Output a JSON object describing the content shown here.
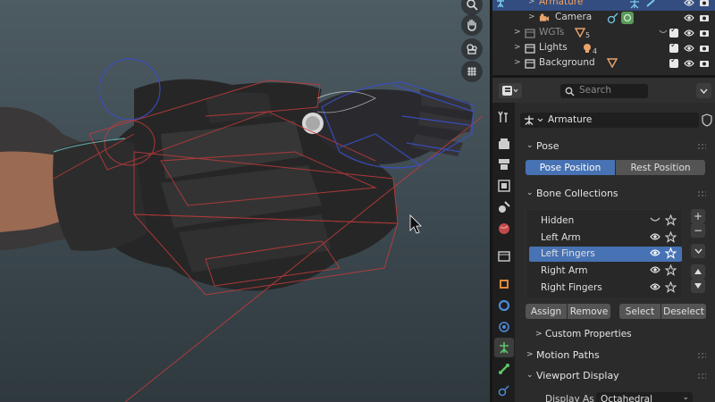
{
  "outliner": {
    "rows": [
      {
        "label": "Armature",
        "badge": ""
      },
      {
        "label": "Camera",
        "badge": ""
      },
      {
        "label": "WGTs",
        "badge": "5"
      },
      {
        "label": "Lights",
        "badge": "4"
      },
      {
        "label": "Background",
        "badge": ""
      }
    ]
  },
  "properties": {
    "search_placeholder": "Search",
    "context_name": "Armature",
    "panels": {
      "pose": "Pose",
      "bone_collections": "Bone Collections",
      "custom_properties": "Custom Properties",
      "motion_paths": "Motion Paths",
      "viewport_display": "Viewport Display"
    },
    "pose_buttons": {
      "pose_position": "Pose Position",
      "rest_position": "Rest Position"
    },
    "bone_collections": [
      {
        "name": "Hidden",
        "visible": false
      },
      {
        "name": "Left Arm",
        "visible": true
      },
      {
        "name": "Left Fingers",
        "visible": true,
        "active": true
      },
      {
        "name": "Right Arm",
        "visible": true
      },
      {
        "name": "Right Fingers",
        "visible": true
      }
    ],
    "bc_buttons": {
      "assign": "Assign",
      "remove": "Remove",
      "select": "Select",
      "deselect": "Deselect"
    },
    "viewport_display": {
      "display_as_label": "Display As",
      "display_as_value": "Octahedral"
    }
  },
  "icons": {
    "navigation": [
      "zoom-icon",
      "hand-pan-icon",
      "camera-view-icon",
      "grid-ortho-icon"
    ],
    "tabs": [
      "tool-icon",
      "render-icon",
      "output-icon",
      "view-layer-icon",
      "scene-icon",
      "world-icon",
      "collection-icon",
      "object-icon",
      "modifiers-icon",
      "particles-icon",
      "physics-icon",
      "armature-data-icon",
      "bone-icon",
      "bone-constraint-icon"
    ]
  },
  "colors": {
    "accent_blue": "#4772b3",
    "selection_orange": "#f5a35a",
    "outliner_selected_bg": "#334d80"
  }
}
